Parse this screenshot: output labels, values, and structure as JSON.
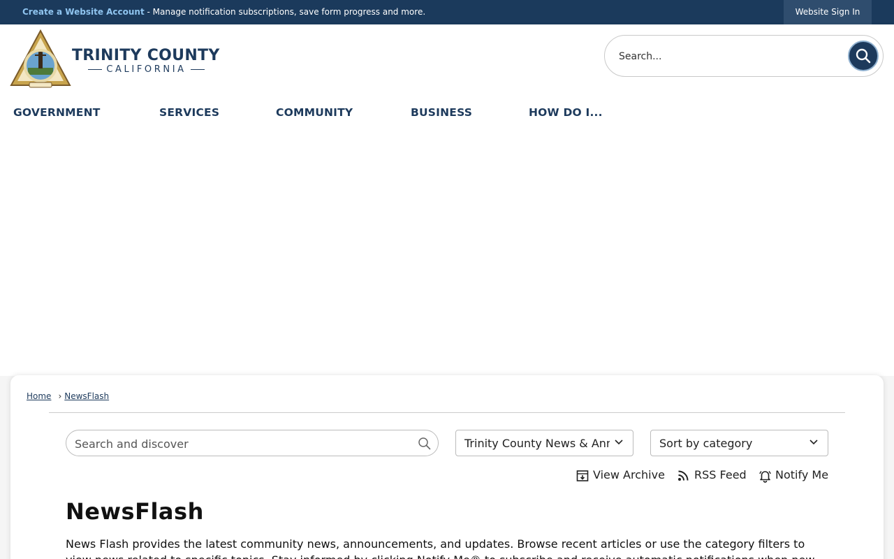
{
  "topbar": {
    "create_account_link": "Create a Website Account",
    "create_account_text": " - Manage notification subscriptions, save form progress and more.",
    "sign_in_label": "Website Sign In"
  },
  "logo": {
    "line1": "TRINITY COUNTY",
    "line2": "CALIFORNIA"
  },
  "header_search": {
    "placeholder": "Search..."
  },
  "nav": {
    "items": [
      {
        "label": "GOVERNMENT"
      },
      {
        "label": "SERVICES"
      },
      {
        "label": "COMMUNITY"
      },
      {
        "label": "BUSINESS"
      },
      {
        "label": "HOW DO I..."
      }
    ]
  },
  "breadcrumb": {
    "home": "Home",
    "current": "NewsFlash",
    "separator": "›"
  },
  "filters": {
    "search_placeholder": "Search and discover",
    "category_value": "Trinity County News & Announcements",
    "sort_value": "Sort by category"
  },
  "actions": {
    "view_archive": "View Archive",
    "rss_feed": "RSS Feed",
    "notify_me": "Notify Me"
  },
  "page": {
    "title": "NewsFlash",
    "description": "News Flash provides the latest community news, announcements, and updates. Browse recent articles or use the category filters to view news related to specific topics. Stay informed by clicking Notify Me® to subscribe and receive automatic notifications when new"
  },
  "colors": {
    "brand_navy": "#1b3a5c",
    "link_light_blue": "#8fc4ef"
  }
}
